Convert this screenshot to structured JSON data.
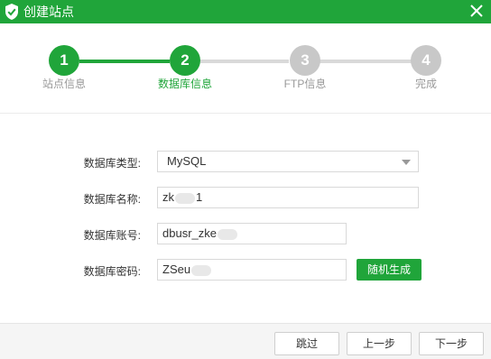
{
  "window": {
    "title": "创建站点",
    "brand_color": "#20a53a",
    "logo_icon": "shield-logo-icon",
    "close_icon": "close-icon"
  },
  "stepper": {
    "steps": [
      {
        "number": "1",
        "label": "站点信息",
        "state": "done"
      },
      {
        "number": "2",
        "label": "数据库信息",
        "state": "current"
      },
      {
        "number": "3",
        "label": "FTP信息",
        "state": "pending"
      },
      {
        "number": "4",
        "label": "完成",
        "state": "pending"
      }
    ]
  },
  "form": {
    "db_type": {
      "label": "数据库类型:",
      "value": "MySQL"
    },
    "db_name": {
      "label": "数据库名称:",
      "value_prefix": "zk",
      "value_suffix": "1"
    },
    "db_user": {
      "label": "数据库账号:",
      "value_prefix": "dbusr_zke"
    },
    "db_password": {
      "label": "数据库密码:",
      "value_prefix": "ZSeu"
    },
    "random_button": "随机生成"
  },
  "footer": {
    "skip": "跳过",
    "prev": "上一步",
    "next": "下一步"
  }
}
